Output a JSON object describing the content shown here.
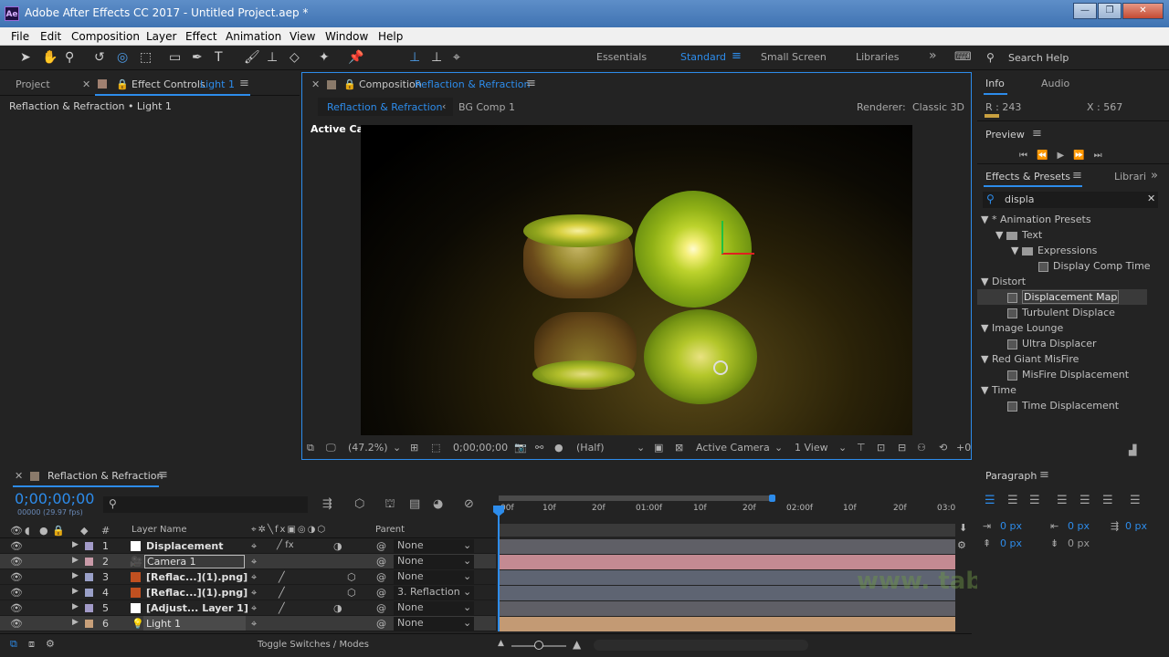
{
  "window": {
    "title": "Adobe After Effects CC 2017 - Untitled Project.aep *",
    "app_icon": "Ae",
    "minimize": "—",
    "maximize": "❐",
    "close": "✕"
  },
  "menu": [
    "File",
    "Edit",
    "Composition",
    "Layer",
    "Effect",
    "Animation",
    "View",
    "Window",
    "Help"
  ],
  "workspaces": {
    "essentials": "Essentials",
    "standard": "Standard",
    "small_screen": "Small Screen",
    "libraries": "Libraries",
    "more": "»"
  },
  "search_help": "Search Help",
  "left_panel": {
    "project_tab": "Project",
    "effect_controls_prefix": "Effect Controls",
    "effect_controls_layer": "Light 1",
    "breadcrumb": "Reflaction & Refraction • Light 1"
  },
  "comp_panel": {
    "tab_prefix": "Composition",
    "tab_name": "Reflaction & Refraction",
    "nav_active": "Reflaction & Refraction",
    "nav_other": "BG Comp 1",
    "renderer_label": "Renderer:",
    "renderer_value": "Classic 3D",
    "view_label": "Active Camera",
    "zoom": "(47.2%)",
    "timecode": "0;00;00;00",
    "resolution": "(Half)",
    "camera": "Active Camera",
    "views": "1 View",
    "exposure": "+0"
  },
  "info_panel": {
    "tab_info": "Info",
    "tab_audio": "Audio",
    "r": "R : 243",
    "x": "X : 567"
  },
  "preview_panel": {
    "tab": "Preview"
  },
  "effects_panel": {
    "tab": "Effects & Presets",
    "tab2": "Librari",
    "search": "displa",
    "tree": [
      {
        "label": "* Animation Presets",
        "level": 0,
        "kind": "arrow"
      },
      {
        "label": "Text",
        "level": 1,
        "kind": "folder"
      },
      {
        "label": "Expressions",
        "level": 2,
        "kind": "folder"
      },
      {
        "label": "Display Comp Time",
        "level": 3,
        "kind": "fx"
      },
      {
        "label": "Distort",
        "level": 0,
        "kind": "arrow"
      },
      {
        "label": "Displacement Map",
        "level": 1,
        "kind": "fx",
        "selected": true
      },
      {
        "label": "Turbulent Displace",
        "level": 1,
        "kind": "fx"
      },
      {
        "label": "Image Lounge",
        "level": 0,
        "kind": "arrow"
      },
      {
        "label": "Ultra Displacer",
        "level": 1,
        "kind": "fx"
      },
      {
        "label": "Red Giant MisFire",
        "level": 0,
        "kind": "arrow"
      },
      {
        "label": "MisFire Displacement",
        "level": 1,
        "kind": "fx"
      },
      {
        "label": "Time",
        "level": 0,
        "kind": "arrow"
      },
      {
        "label": "Time Displacement",
        "level": 1,
        "kind": "fx"
      }
    ]
  },
  "timeline": {
    "tab": "Reflaction & Refraction",
    "timecode": "0;00;00;00",
    "fps": "00000 (29.97 fps)",
    "header": {
      "num": "#",
      "layer_name": "Layer Name",
      "parent": "Parent"
    },
    "ruler": [
      "00f",
      "10f",
      "20f",
      "01:00f",
      "10f",
      "20f",
      "02:00f",
      "10f",
      "20f",
      "03:0"
    ],
    "layers": [
      {
        "num": "1",
        "name": "Displacement",
        "color": "#a29ac8",
        "parent": "None",
        "bar": "#6a6a6a",
        "selected": false
      },
      {
        "num": "2",
        "name": "Camera 1",
        "color": "#c99aa8",
        "parent": "None",
        "bar": "#c48a92",
        "selected": true
      },
      {
        "num": "3",
        "name": "[Reflac...](1).png]",
        "color": "#9aa0c8",
        "parent": "None",
        "bar": "#5e6472",
        "selected": false
      },
      {
        "num": "4",
        "name": "[Reflac...](1).png]",
        "color": "#9aa0c8",
        "parent": "3. Reflaction &",
        "bar": "#5e6472",
        "selected": false
      },
      {
        "num": "5",
        "name": "[Adjust... Layer 1]",
        "color": "#a29ac8",
        "parent": "None",
        "bar": "#6a6a6a",
        "selected": false
      },
      {
        "num": "6",
        "name": "Light 1",
        "color": "#c8a07a",
        "parent": "None",
        "bar": "#c39a74",
        "selected": true
      }
    ],
    "toggle_label": "Toggle Switches / Modes"
  },
  "paragraph_panel": {
    "tab": "Paragraph",
    "values": [
      "0 px",
      "0 px",
      "0 px",
      "0 px",
      "0 px"
    ]
  },
  "watermark": "www.   tab.net",
  "colors": {
    "accent": "#2d8ceb",
    "panel": "#232323"
  }
}
